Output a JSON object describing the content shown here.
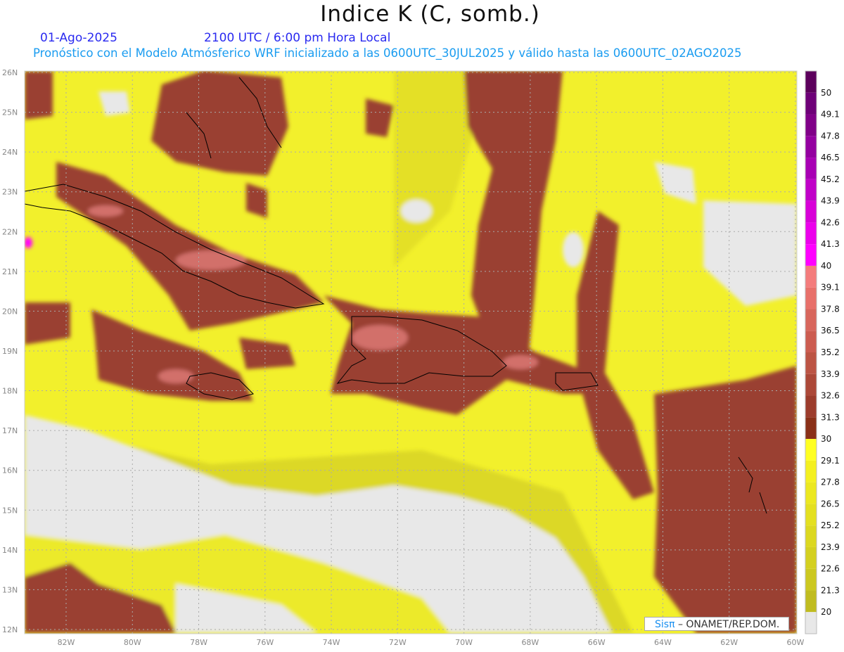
{
  "header": {
    "title": "Indice K (C, somb.)",
    "date": "01-Ago-2025",
    "time": "2100 UTC / 6:00 pm Hora Local",
    "description": "Pronóstico con el Modelo Atmósferico WRF inicializado a las 0600UTC_30JUL2025 y válido hasta las  0600UTC_02AGO2025"
  },
  "axes": {
    "lat_labels": [
      "26N",
      "25N",
      "24N",
      "23N",
      "22N",
      "21N",
      "20N",
      "19N",
      "18N",
      "17N",
      "16N",
      "15N",
      "14N",
      "13N",
      "12N"
    ],
    "lon_labels": [
      "82W",
      "80W",
      "78W",
      "76W",
      "74W",
      "72W",
      "70W",
      "68W",
      "66W",
      "64W",
      "62W",
      "60W"
    ]
  },
  "colorbar": {
    "labels": [
      "50",
      "49.1",
      "47.8",
      "46.5",
      "45.2",
      "43.9",
      "42.6",
      "41.3",
      "40",
      "39.1",
      "37.8",
      "36.5",
      "35.2",
      "33.9",
      "32.6",
      "31.3",
      "30",
      "29.1",
      "27.8",
      "26.5",
      "25.2",
      "23.9",
      "22.6",
      "21.3",
      "20"
    ],
    "colors": [
      "#5c005c",
      "#6e0078",
      "#800088",
      "#9400a0",
      "#a800b4",
      "#c000c8",
      "#d800d8",
      "#ec00ec",
      "#ff00ff",
      "#f47c7c",
      "#e8706a",
      "#d8665c",
      "#cc5c50",
      "#bc5444",
      "#ac4838",
      "#9c3c2c",
      "#8a3018",
      "#ffff22",
      "#f4f020",
      "#ece820",
      "#e4e020",
      "#dcd820",
      "#d4d020",
      "#ccc820",
      "#c0bc20",
      "#e8e8e8"
    ]
  },
  "credit": {
    "brand": "Sisπ",
    "text": "– ONAMET/REP.DOM."
  }
}
